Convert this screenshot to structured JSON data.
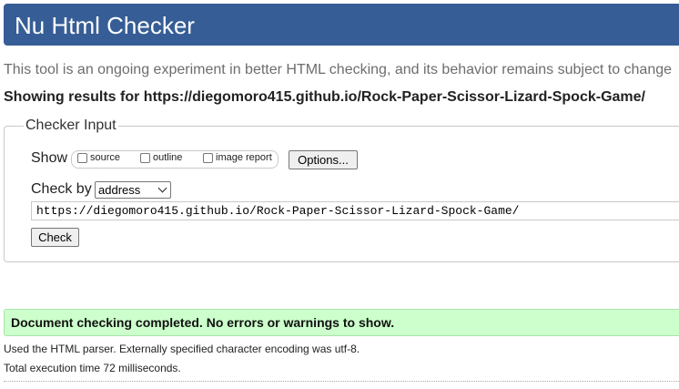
{
  "header": {
    "title": "Nu Html Checker"
  },
  "tagline": "This tool is an ongoing experiment in better HTML checking, and its behavior remains subject to change",
  "results_for": "Showing results for https://diegomoro415.github.io/Rock-Paper-Scissor-Lizard-Spock-Game/",
  "checker_input": {
    "legend": "Checker Input",
    "show_label": "Show",
    "show_options": [
      {
        "label": "source",
        "checked": false
      },
      {
        "label": "outline",
        "checked": false
      },
      {
        "label": "image report",
        "checked": false
      }
    ],
    "options_button": "Options...",
    "check_by_label": "Check by",
    "check_by_value": "address",
    "url_value": "https://diegomoro415.github.io/Rock-Paper-Scissor-Lizard-Spock-Game/",
    "check_button": "Check"
  },
  "result": {
    "message": "Document checking completed. No errors or warnings to show.",
    "parser_info": "Used the HTML parser. Externally specified character encoding was utf-8.",
    "execution_time": "Total execution time 72 milliseconds."
  },
  "colors": {
    "header_bg": "#365d95",
    "success_bg": "#ccffcc"
  }
}
